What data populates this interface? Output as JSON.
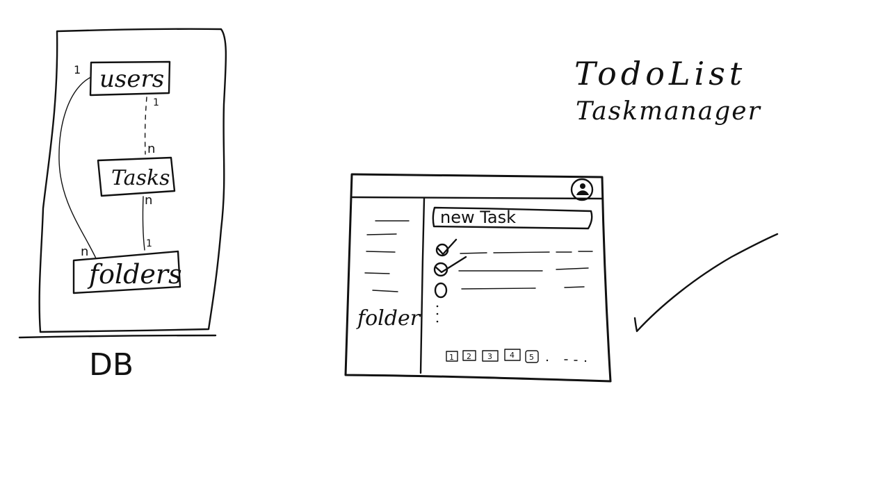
{
  "title": {
    "line1": "TodoList",
    "line2": "Taskmanager"
  },
  "db": {
    "label": "DB",
    "entities": [
      {
        "name": "users"
      },
      {
        "name": "Tasks"
      },
      {
        "name": "folders"
      }
    ],
    "relations": {
      "users_tasks": {
        "from": "1",
        "to": "n"
      },
      "tasks_folders": {
        "from": "n",
        "to": "1"
      },
      "users_folders": {
        "from": "1",
        "to": "n"
      }
    }
  },
  "mockup": {
    "new_task_placeholder": "new Task",
    "sidebar_label": "folder",
    "pages": [
      "1",
      "2",
      "3",
      "4",
      "5"
    ],
    "avatar_icon": "user-avatar-icon"
  },
  "colors": {
    "ink": "#111111",
    "background": "#ffffff"
  }
}
